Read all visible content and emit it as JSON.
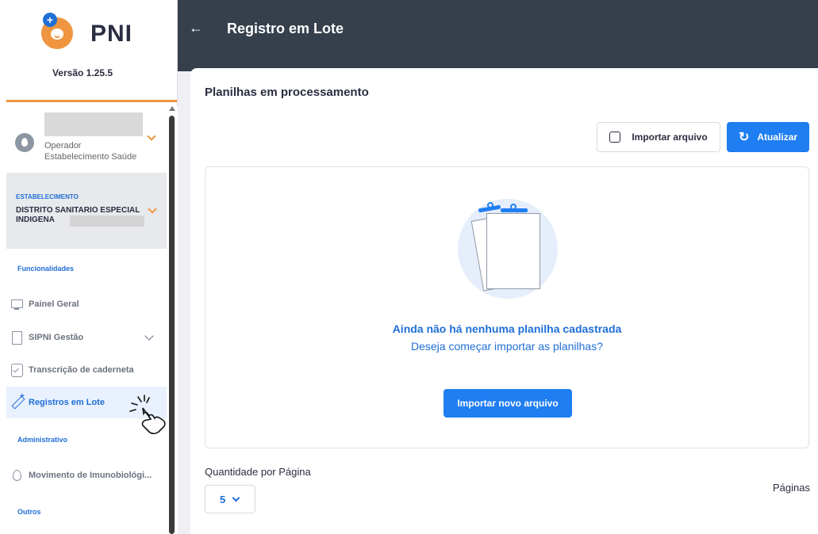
{
  "sidebar": {
    "brand": "PNI",
    "version": "Versão 1.25.5",
    "user": {
      "role_line1": "Operador",
      "role_line2": "Estabelecimento Saúde"
    },
    "establishment": {
      "label": "ESTABELECIMENTO",
      "value": "DISTRITO SANITARIO ESPECIAL INDIGENA"
    },
    "sections": {
      "funcionalidades": "Funcionalidades",
      "administrativo": "Administrativo",
      "outros": "Outros"
    },
    "items": [
      {
        "label": "Painel Geral",
        "icon": "monitor-icon"
      },
      {
        "label": "SIPNI Gestão",
        "icon": "document-icon"
      },
      {
        "label": "Transcrição de caderneta",
        "icon": "checklist-icon"
      },
      {
        "label": "Registros em Lote",
        "icon": "syringe-icon",
        "active": true
      },
      {
        "label": "Movimento de Imunobiológi...",
        "icon": "drop-icon"
      }
    ]
  },
  "header": {
    "back_icon": "arrow-left-icon",
    "title": "Registro em Lote"
  },
  "main": {
    "card_title": "Planilhas em processamento",
    "import_button": "Importar arquivo",
    "update_button": "Atualizar",
    "empty_title": "Ainda não há nenhuma planilha cadastrada",
    "empty_subtitle": "Deseja começar importar as planilhas?",
    "new_file_button": "Importar novo arquivo",
    "quantity_label": "Quantidade por Página",
    "quantity_value": "5",
    "pages_label": "Páginas"
  },
  "colors": {
    "primary": "#1f7ef2",
    "accent": "#f0953f",
    "header": "#363f4c"
  }
}
